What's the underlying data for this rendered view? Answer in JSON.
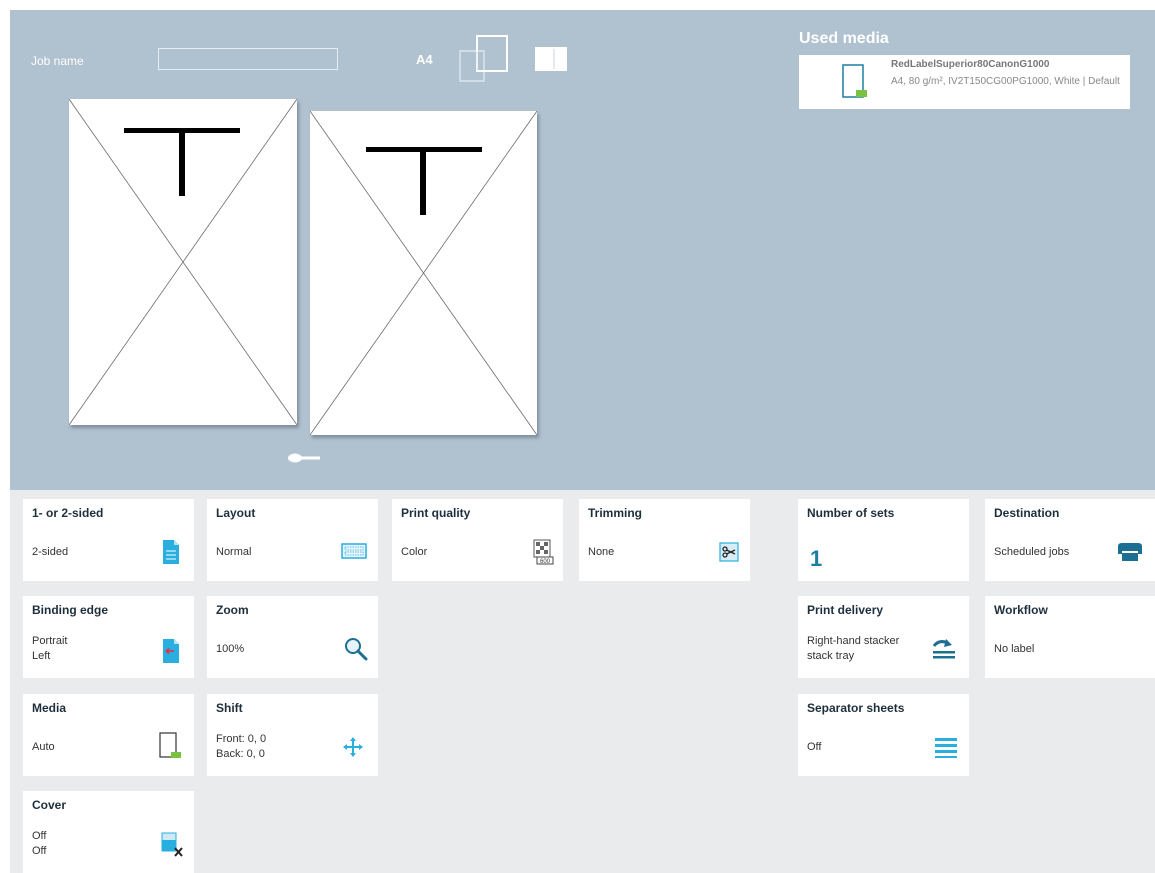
{
  "preview": {
    "job_name_label": "Job name",
    "job_name_value": "",
    "paper_size": "A4",
    "page_marks": [
      "T",
      "T"
    ]
  },
  "used_media": {
    "title": "Used media",
    "name": "RedLabelSuperior80CanonG1000",
    "properties": "A4, 80 g/m², IV2T150CG00PG1000, White | Default"
  },
  "tiles": {
    "sides": {
      "title": "1- or 2-sided",
      "value": "2-sided"
    },
    "layout": {
      "title": "Layout",
      "value": "Normal"
    },
    "print_quality": {
      "title": "Print quality",
      "value": "Color"
    },
    "trimming": {
      "title": "Trimming",
      "value": "None"
    },
    "number_of_sets": {
      "title": "Number of sets",
      "value": "1"
    },
    "destination": {
      "title": "Destination",
      "value": "Scheduled jobs"
    },
    "binding_edge": {
      "title": "Binding edge",
      "line1": "Portrait",
      "line2": "Left"
    },
    "zoom": {
      "title": "Zoom",
      "value": "100%"
    },
    "print_delivery": {
      "title": "Print delivery",
      "line1": "Right-hand stacker",
      "line2": "stack tray"
    },
    "workflow": {
      "title": "Workflow",
      "value": "No label"
    },
    "media": {
      "title": "Media",
      "value": "Auto"
    },
    "shift": {
      "title": "Shift",
      "line1": "Front: 0, 0",
      "line2": "Back: 0, 0"
    },
    "separator_sheets": {
      "title": "Separator sheets",
      "value": "Off"
    },
    "cover": {
      "title": "Cover",
      "line1": "Off",
      "line2": "Off"
    }
  },
  "colors": {
    "preview_bg": "#b0c1d0",
    "settings_bg": "#e9ebec",
    "accent_blue": "#1c7fa1",
    "icon_cyan": "#29aee0",
    "icon_green": "#7cc242"
  },
  "icons": {
    "sides": "two-sided-page-icon",
    "layout": "keyboard-layout-icon",
    "print_quality": "print-quality-icon",
    "trimming": "scissors-trim-icon",
    "destination": "printer-icon",
    "binding_edge": "binding-edge-icon",
    "zoom": "magnifier-icon",
    "print_delivery": "stacker-delivery-icon",
    "media": "media-sheet-icon",
    "shift": "move-arrows-icon",
    "separator_sheets": "separator-lines-icon",
    "cover": "cover-off-icon"
  }
}
